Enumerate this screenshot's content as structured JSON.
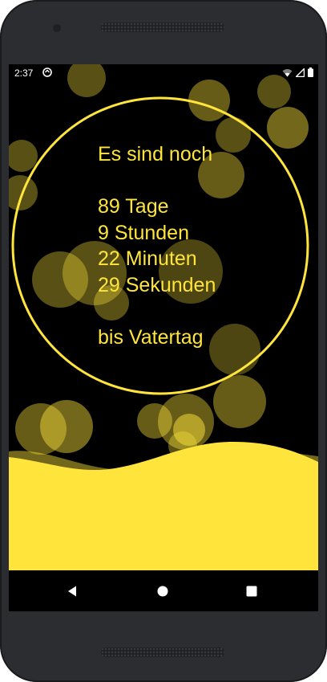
{
  "status_bar": {
    "time": "2:37",
    "icons": [
      "app-notification-icon",
      "wifi-icon",
      "signal-icon",
      "battery-icon"
    ]
  },
  "countdown": {
    "intro": "Es sind noch",
    "days": "89 Tage",
    "hours": "9 Stunden",
    "minutes": "22 Minuten",
    "seconds": "29 Sekunden",
    "outro": "bis Vatertag"
  },
  "theme": {
    "accent": "#ffe53b",
    "background": "#000000"
  },
  "navigation": {
    "buttons": [
      "back-icon",
      "home-icon",
      "recents-icon"
    ]
  }
}
